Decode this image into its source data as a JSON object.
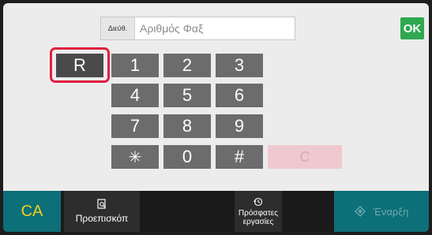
{
  "address": {
    "dir_label": "Διεύθ.",
    "placeholder": "Αριθμός Φαξ"
  },
  "ok_label": "OK",
  "keypad": {
    "r": "R",
    "k1": "1",
    "k2": "2",
    "k3": "3",
    "k4": "4",
    "k5": "5",
    "k6": "6",
    "k7": "7",
    "k8": "8",
    "k9": "9",
    "star": "✳",
    "k0": "0",
    "hash": "#",
    "clear": "C"
  },
  "bottom": {
    "ca_label": "CA",
    "preview_label": "Προεπισκόπ",
    "recent_line1": "Πρόσφατες",
    "recent_line2": "εργασίες",
    "start_label": "Έναρξη"
  },
  "icons": {
    "preview": "preview-icon",
    "recent": "history-icon",
    "start": "start-diamond-icon"
  },
  "colors": {
    "ok": "#2fa84f",
    "highlight": "#e0203f",
    "ca_text": "#f0d020",
    "teal": "#0d6f78"
  }
}
